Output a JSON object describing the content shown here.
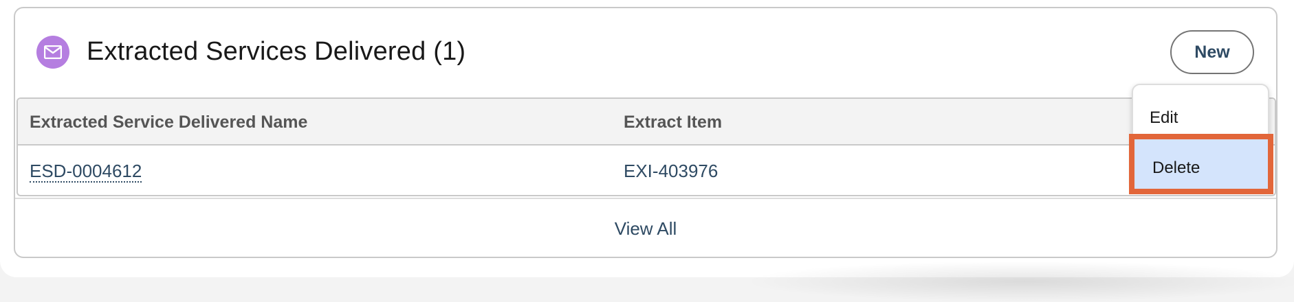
{
  "card": {
    "title": "Extracted Services Delivered (1)",
    "icon": "envelope-icon",
    "new_label": "New"
  },
  "table": {
    "columns": [
      "Extracted Service Delivered Name",
      "Extract Item"
    ],
    "rows": [
      [
        "ESD-0004612",
        "EXI-403976"
      ]
    ]
  },
  "footer": {
    "view_all_label": "View All"
  },
  "menu": {
    "items": [
      {
        "label": "Edit"
      },
      {
        "label": "Delete",
        "highlighted": true
      }
    ]
  },
  "colors": {
    "icon_bg": "#b57ee0",
    "link": "#2e4a63",
    "highlight_border": "#e2663a",
    "highlight_bg": "#d4e4fc"
  }
}
